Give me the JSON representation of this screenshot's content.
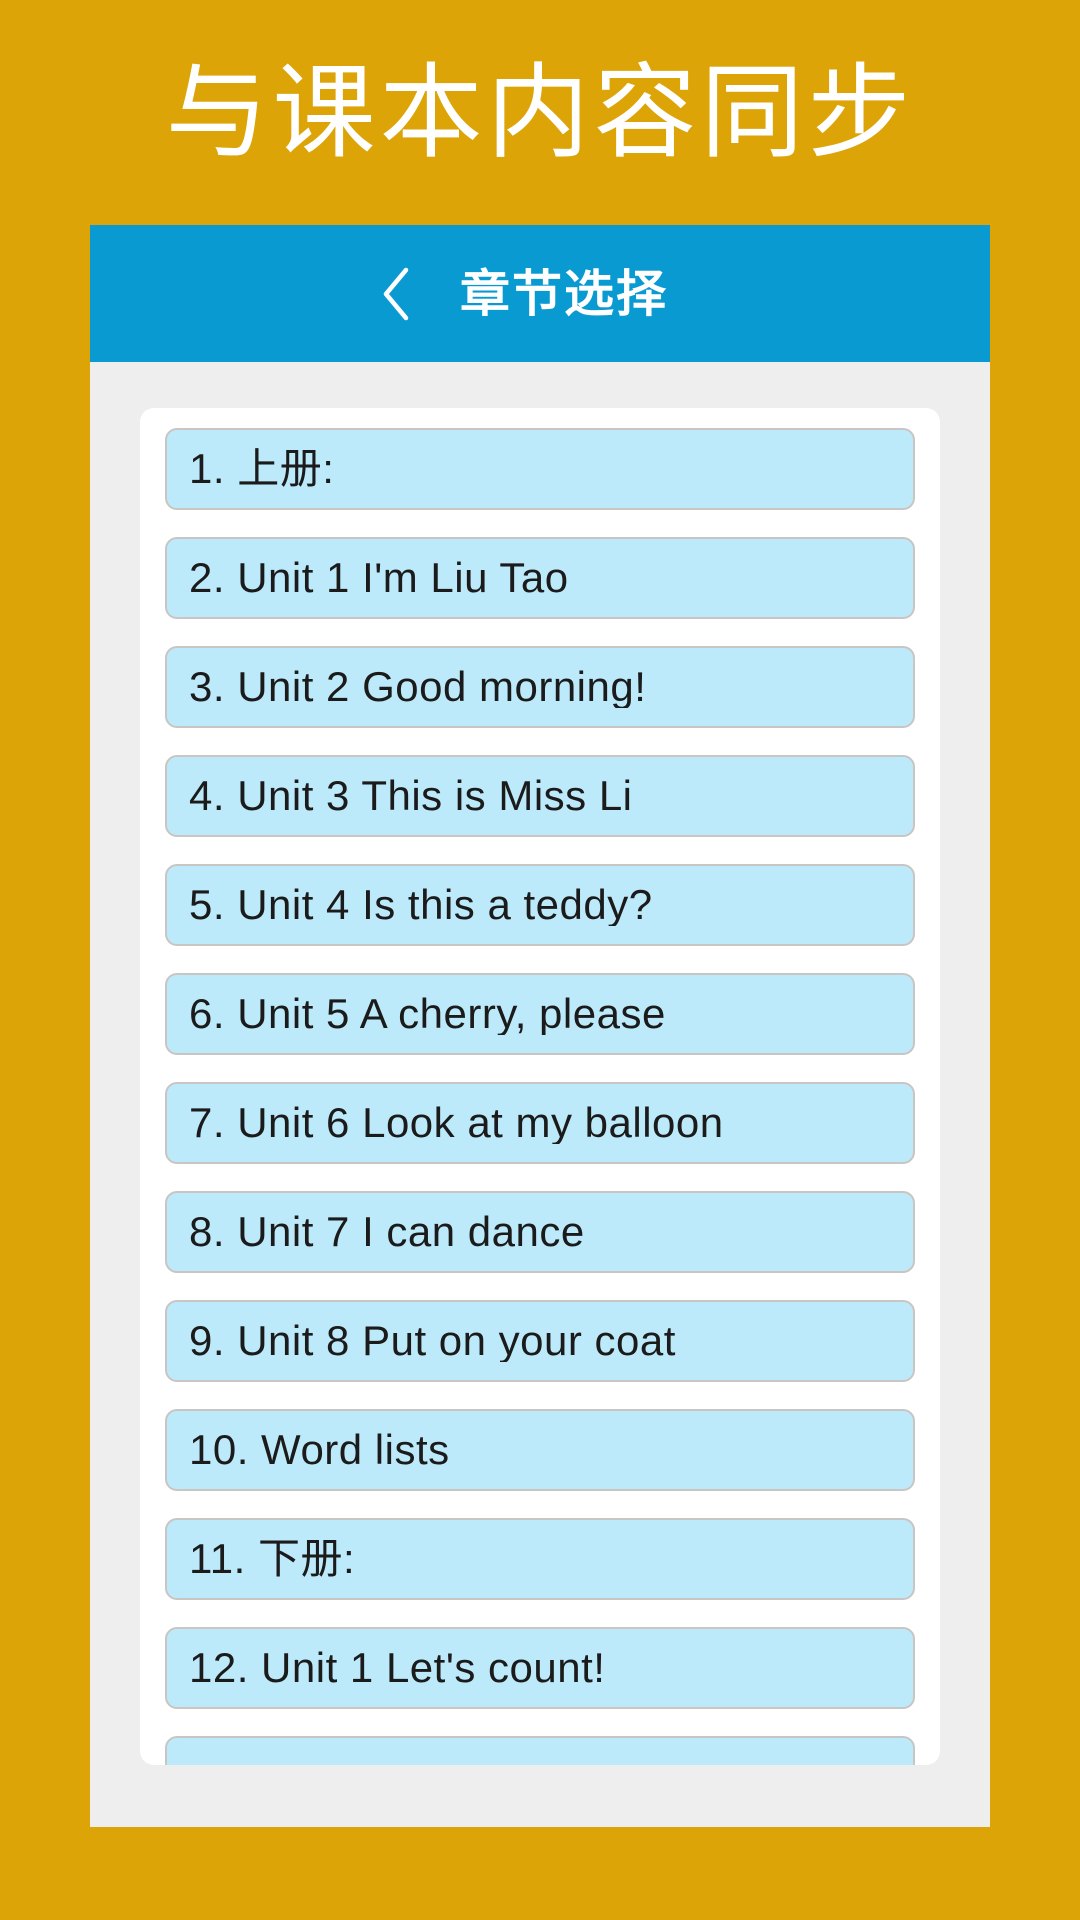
{
  "promo": {
    "headline": "与课本内容同步"
  },
  "theme": {
    "promo_background": "#dca406",
    "appbar_background": "#0a9ad2",
    "screen_background": "#eeeeee",
    "card_background": "#ffffff",
    "item_fill": "#bdeafb",
    "item_border": "#c9c5c2",
    "item_text": "#1b1b1b",
    "appbar_text": "#ffffff"
  },
  "appbar": {
    "back_icon": "chevron-left-icon",
    "title": "章节选择"
  },
  "chapters": [
    {
      "label": "1. 上册:"
    },
    {
      "label": "2. Unit 1 I'm Liu Tao"
    },
    {
      "label": "3. Unit 2 Good morning!"
    },
    {
      "label": "4. Unit 3 This is Miss Li"
    },
    {
      "label": "5. Unit 4 Is this a teddy?"
    },
    {
      "label": "6. Unit 5 A cherry, please"
    },
    {
      "label": "7. Unit 6 Look at my balloon"
    },
    {
      "label": "8. Unit 7 I can dance"
    },
    {
      "label": "9. Unit 8 Put on your coat"
    },
    {
      "label": "10. Word lists"
    },
    {
      "label": "11. 下册:"
    },
    {
      "label": "12. Unit 1 Let's count!"
    },
    {
      "label": ""
    }
  ]
}
